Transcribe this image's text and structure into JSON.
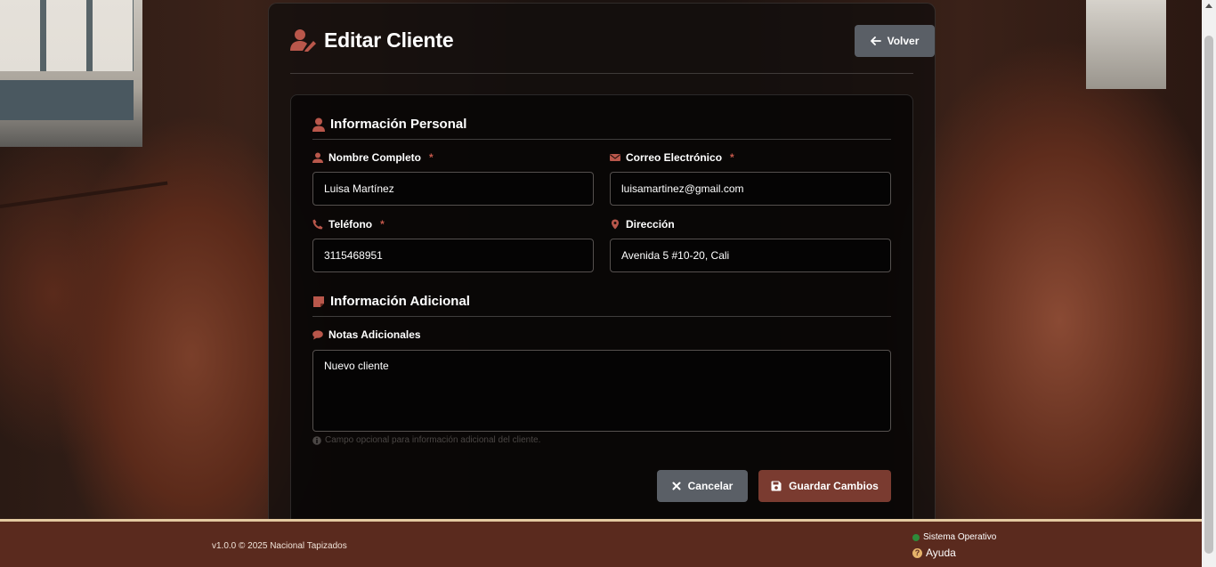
{
  "header": {
    "title": "Editar Cliente",
    "back_label": "Volver"
  },
  "personal": {
    "section_title": "Información Personal",
    "name": {
      "label": "Nombre Completo",
      "required": "*",
      "value": "Luisa Martínez"
    },
    "email": {
      "label": "Correo Electrónico",
      "required": "*",
      "value": "luisamartinez@gmail.com"
    },
    "phone": {
      "label": "Teléfono",
      "required": "*",
      "value": "3115468951"
    },
    "address": {
      "label": "Dirección",
      "value": "Avenida 5 #10-20, Cali"
    }
  },
  "additional": {
    "section_title": "Información Adicional",
    "notes": {
      "label": "Notas Adicionales",
      "value": "Nuevo cliente"
    },
    "hint": "Campo opcional para información adicional del cliente."
  },
  "actions": {
    "cancel_label": "Cancelar",
    "save_label": "Guardar Cambios"
  },
  "footer": {
    "version": "v1.0.0 © 2025 Nacional Tapizados",
    "status": "Sistema Operativo",
    "help": "Ayuda"
  },
  "colors": {
    "accent": "#7a3b30",
    "icon": "#b9574b",
    "footer_bg": "#5a2a1e",
    "status_ok": "#2e8b3a"
  },
  "icons": {
    "title": "user-edit-icon",
    "back": "arrow-left-icon",
    "personal": "user-icon",
    "email": "envelope-icon",
    "phone": "phone-icon",
    "address": "map-marker-icon",
    "additional": "sticky-note-icon",
    "notes": "comment-icon",
    "hint": "info-circle-icon",
    "cancel": "times-icon",
    "save": "floppy-disk-icon",
    "help": "question-circle-icon"
  }
}
